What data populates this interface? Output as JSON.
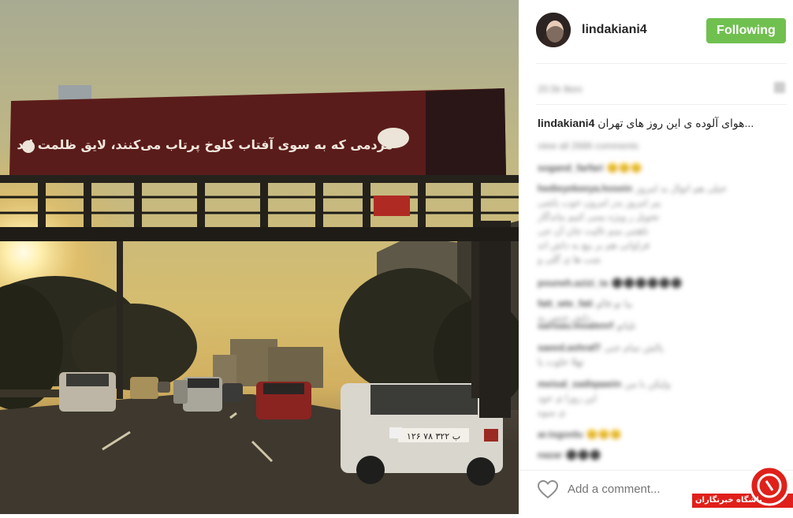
{
  "post": {
    "username": "lindakiani4",
    "follow_label": "Following",
    "time_ago": "20.5k likes",
    "caption_username": "lindakiani4",
    "caption_text": "هوای آلوده ی این روز های تهران...",
    "add_comment_placeholder": "Add a comment..."
  },
  "billboard": {
    "text": "مردمی که به سوی آفتاب کلوخ پرتاب می‌کنند، لایق ظلمت اند"
  },
  "plate": {
    "text": "۱۲۶ ب ۳۲۲ ۷۸"
  },
  "comments": [
    {
      "user": "view all 2686 comments",
      "text": ""
    },
    {
      "user": "sogand_farfari",
      "text": "😊😊😊"
    },
    {
      "user": "hedieyekeeya.hosein",
      "text": "خیلی هم اتوال بد امروز"
    },
    {
      "user": "",
      "text": "بیر امروز بدر امرون خوب یاشی"
    },
    {
      "user": "",
      "text": "تحویل ر ویژه بسی کنیم ماندگار"
    },
    {
      "user": "",
      "text": "ناهتنی منم تالیت جان آن جی"
    },
    {
      "user": "",
      "text": "فراوانی هم بر بیع به داش اند"
    },
    {
      "user": "",
      "text": "شب ها ی گلی و"
    },
    {
      "user": "pouneh.azizi_ta",
      "text": "⚫⚫⚫⚫⚫⚫"
    },
    {
      "user": "fatt_wte_fati",
      "text": "بیا تو فالو"
    },
    {
      "user": "",
      "text": "دلش جنس یه"
    },
    {
      "user": "sarisau.moalenrf",
      "text": "تلیاتو"
    },
    {
      "user": "saeed.ashraf7",
      "text": "پالش تمام خنی"
    },
    {
      "user": "",
      "text": "تهلا خلوت یا"
    },
    {
      "user": "meisal_sadiqaaein",
      "text": "ولیکن با من"
    },
    {
      "user": "",
      "text": "این روزا ی خود"
    },
    {
      "user": "",
      "text": "ی سوه"
    },
    {
      "user": "ar.tsgonlu",
      "text": "😊😊😊"
    },
    {
      "user": "nazar",
      "text": "⚫⚫⚫"
    }
  ],
  "watermark": {
    "text": "باشگاه خبرنگاران"
  },
  "colors": {
    "follow_bg": "#70c050",
    "watermark_red": "#e0201a"
  }
}
